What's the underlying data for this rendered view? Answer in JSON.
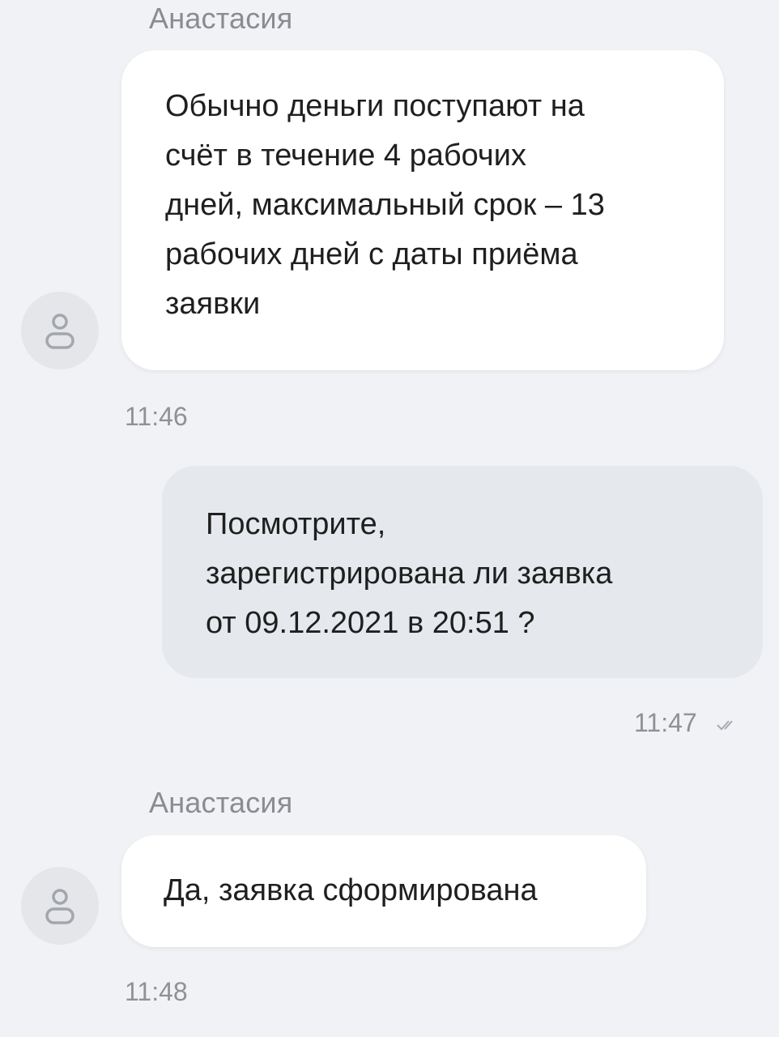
{
  "messages": [
    {
      "sender": "Анастасия",
      "direction": "incoming",
      "text_lines": [
        "Обычно деньги поступают на",
        "счёт в течение 4 рабочих",
        "дней, максимальный срок – 13",
        "рабочих дней с даты приёма",
        "заявки"
      ],
      "time": "11:46",
      "avatar_icon": "user-icon"
    },
    {
      "direction": "outgoing",
      "text_lines": [
        "Посмотрите,",
        "зарегистрирована ли заявка",
        "от 09.12.2021 в 20:51 ?"
      ],
      "time": "11:47",
      "status_icon": "double-check-icon"
    },
    {
      "sender": "Анастасия",
      "direction": "incoming",
      "text_lines": [
        "Да, заявка сформирована"
      ],
      "time": "11:48",
      "avatar_icon": "user-icon"
    }
  ],
  "colors": {
    "background": "#f1f2f5",
    "incoming_bubble": "#ffffff",
    "outgoing_bubble": "#e5e8ec",
    "meta_text": "#8a8c91"
  }
}
